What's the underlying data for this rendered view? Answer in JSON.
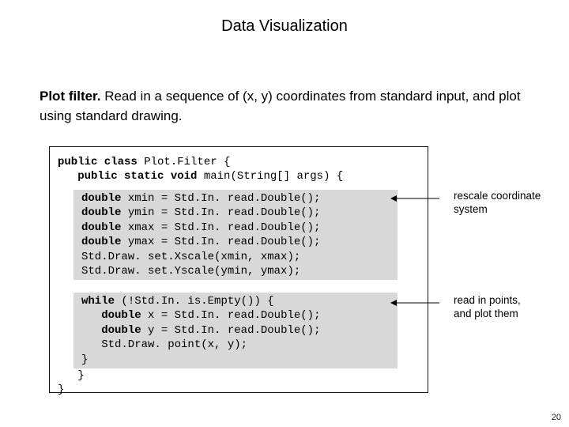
{
  "title": "Data Visualization",
  "lead_run": "Plot filter.",
  "lead_text": "  Read in a sequence of (x, y) coordinates from standard input, and plot using standard drawing.",
  "code": {
    "class_decl_pre": "public class",
    "class_name": " Plot.Filter {",
    "main_indent": "   ",
    "main_sig_kw": "public static void",
    "main_sig_rest": " main(String[] args) {",
    "b1_l1_kw": "double",
    "b1_l1": " xmin = Std.In. read.Double();",
    "b1_l2_kw": "double",
    "b1_l2": " ymin = Std.In. read.Double();",
    "b1_l3_kw": "double",
    "b1_l3": " xmax = Std.In. read.Double();",
    "b1_l4_kw": "double",
    "b1_l4": " ymax = Std.In. read.Double();",
    "b1_l5": "Std.Draw. set.Xscale(xmin, xmax);",
    "b1_l6": "Std.Draw. set.Yscale(ymin, ymax);",
    "b2_l1_kw": "while",
    "b2_l1": " (!Std.In. is.Empty()) {",
    "b2_l2_pre": "   ",
    "b2_l2_kw": "double",
    "b2_l2": " x = Std.In. read.Double();",
    "b2_l3_pre": "   ",
    "b2_l3_kw": "double",
    "b2_l3": " y = Std.In. read.Double();",
    "b2_l4": "   Std.Draw. point(x, y);",
    "b2_l5": "}",
    "close_main": "   }",
    "close_class": "}"
  },
  "annotations": {
    "a1_l1": "rescale coordinate",
    "a1_l2": "system",
    "a2_l1": "read in points,",
    "a2_l2": "and plot them"
  },
  "page_number": "20"
}
